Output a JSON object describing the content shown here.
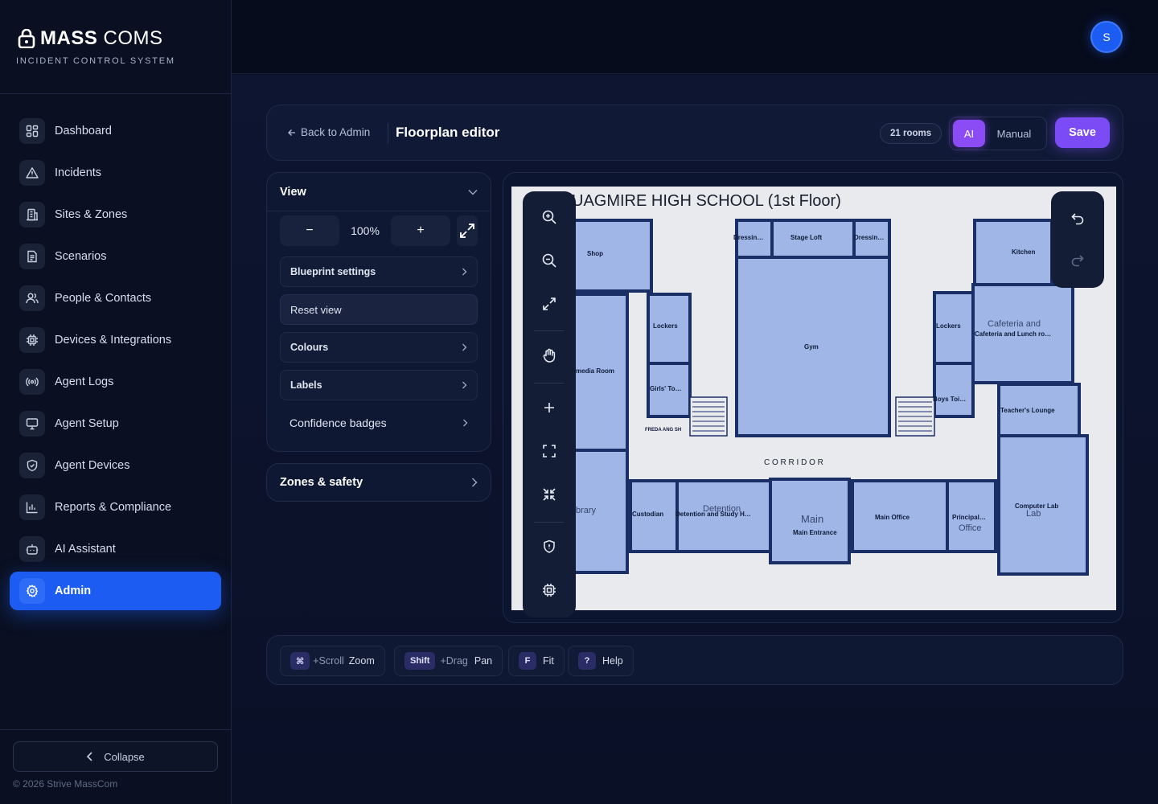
{
  "brand": {
    "name_bold": "MASS",
    "name_light": "COMS",
    "subtitle": "INCIDENT CONTROL SYSTEM"
  },
  "sidebar": {
    "items": [
      {
        "label": "Dashboard",
        "icon": "dashboard-icon"
      },
      {
        "label": "Incidents",
        "icon": "warning-icon"
      },
      {
        "label": "Sites & Zones",
        "icon": "building-icon"
      },
      {
        "label": "Scenarios",
        "icon": "document-icon"
      },
      {
        "label": "People & Contacts",
        "icon": "people-icon"
      },
      {
        "label": "Devices & Integrations",
        "icon": "chip-icon"
      },
      {
        "label": "Agent Logs",
        "icon": "broadcast-icon"
      },
      {
        "label": "Agent Setup",
        "icon": "monitor-icon"
      },
      {
        "label": "Agent Devices",
        "icon": "shield-icon"
      },
      {
        "label": "Reports & Compliance",
        "icon": "bar-chart-icon"
      },
      {
        "label": "AI Assistant",
        "icon": "robot-icon"
      },
      {
        "label": "Admin",
        "icon": "gear-icon",
        "active": true
      }
    ],
    "collapse_label": "Collapse",
    "copyright": "© 2026 Strive MassCom"
  },
  "topbar": {
    "avatar_initial": "S"
  },
  "editor": {
    "back_label": "Back to Admin",
    "title": "Floorplan editor",
    "rooms_badge": "21 rooms",
    "mode_ai": "AI",
    "mode_manual": "Manual",
    "active_mode": "AI",
    "save_label": "Save"
  },
  "view_panel": {
    "title": "View",
    "zoom_minus": "−",
    "zoom_value": "100%",
    "zoom_plus": "+",
    "options": {
      "blueprint": "Blueprint settings",
      "reset": "Reset view",
      "colours": "Colours",
      "labels": "Labels",
      "confidence": "Confidence badges"
    }
  },
  "zones_panel": {
    "title": "Zones & safety"
  },
  "floorplan": {
    "title": "UAGMIRE HIGH SCHOOL (1st Floor)",
    "corridor": "C O R R I D O R",
    "rooms": {
      "shop": "Shop",
      "dressing_left": "Dressin…",
      "stage_loft": "Stage Loft",
      "dressing_right": "Dressin…",
      "kitchen": "Kitchen",
      "lockers_left": "Lockers",
      "gym": "Gym",
      "lockers_right": "Lockers",
      "cafeteria": "Cafeteria and Lunch ro…",
      "cafeteria_print": "Cafeteria and",
      "media_room": "media Room",
      "girls_toilet": "Girls' To…",
      "boys_toilet": "Boys Toi…",
      "teachers_lounge": "Teacher's Lounge",
      "custodian": "Custodian",
      "detention": "Detention and Study H…",
      "detention_print": "Detention",
      "main_entrance": "Main Entrance",
      "main_print": "Main",
      "main_office": "Main Office",
      "principal": "Principal…",
      "principal_print": "Office",
      "computer_lab": "Computer Lab",
      "computer_print": "Lab",
      "library_print": "brary",
      "freda": "FREDA ANG SH"
    }
  },
  "shortcuts": [
    {
      "key": "⌘",
      "extra": "+Scroll",
      "action": "Zoom"
    },
    {
      "key": "Shift",
      "extra": "+Drag",
      "action": "Pan"
    },
    {
      "key": "F",
      "extra": "",
      "action": "Fit"
    },
    {
      "key": "?",
      "extra": "",
      "action": "Help"
    }
  ],
  "colors": {
    "accent": "#1d5cf2",
    "ai_purple": "#8b4cf6",
    "room_fill": "#9fb6e6",
    "wall": "#1a2f66"
  }
}
